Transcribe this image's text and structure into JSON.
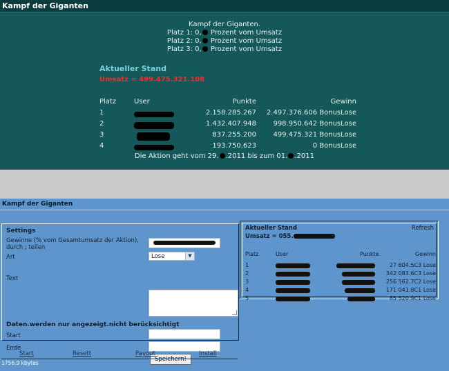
{
  "top": {
    "title": "Kampf der Giganten",
    "intro": {
      "heading": "Kampf der Giganten.",
      "lines": [
        {
          "prefix": "Platz 1: 0,",
          "suffix": " Prozent vom Umsatz"
        },
        {
          "prefix": "Platz 2: 0,",
          "suffix": " Prozent vom Umsatz"
        },
        {
          "prefix": "Platz 3: 0,",
          "suffix": " Prozent vom Umsatz"
        }
      ]
    },
    "stand_label": "Aktueller Stand",
    "umsatz": "Umsatz = 499.475.321.108",
    "headers": {
      "platz": "Platz",
      "user": "User",
      "punkte": "Punkte",
      "gewinn": "Gewinn"
    },
    "rows": [
      {
        "platz": "1",
        "punkte": "2.158.285.267",
        "gewinn": "2.497.376.606 BonusLose"
      },
      {
        "platz": "2",
        "punkte": "1.432.407.948",
        "gewinn": "998.950.642 BonusLose"
      },
      {
        "platz": "3",
        "punkte": "837.255.200",
        "gewinn": "499.475.321 BonusLose"
      },
      {
        "platz": "4",
        "punkte": "193.750.623",
        "gewinn": "0 BonusLose"
      }
    ],
    "aktion": {
      "p1": "Die Aktion geht vom 29.",
      "p2": ".2011 bis zum 01.",
      "p3": ".2011"
    }
  },
  "bottom": {
    "title": "Kampf der Giganten",
    "settings": {
      "title": "Settings",
      "gewinne_label": "Gewinne (% vom Gesamtumsatz der Aktion), durch ; teilen",
      "art_label": "Art",
      "art_value": "Lose",
      "text_label": "Text",
      "daten_label": "Daten.werden nur angezeigt.nicht berücksichtigt",
      "start_label": "Start",
      "ende_label": "Ende",
      "save_label": "Speichern!"
    },
    "tabs": [
      "Start",
      "Resett",
      "Payout",
      "Install"
    ],
    "filesize": "1756.9 kbytes",
    "stand": {
      "title": "Aktueller Stand",
      "refresh": "Refresh",
      "umsatz_prefix": "Umsatz = 055.",
      "headers": {
        "platz": "Platz",
        "user": "User",
        "punkte": "Punkte",
        "gewinn": "Gewinn"
      },
      "rows": [
        {
          "platz": "1",
          "gewinn": "27 604.5C3 Lose"
        },
        {
          "platz": "2",
          "gewinn": "342 083.6C3 Lose"
        },
        {
          "platz": "3",
          "gewinn": "256 562.7C2 Lose"
        },
        {
          "platz": "4",
          "gewinn": "171 041.8C1 Lose"
        },
        {
          "platz": "5",
          "gewinn": "85 520.9C1 Lose"
        }
      ]
    }
  },
  "colors": {
    "teal": "#15585a",
    "blue": "#5e95cc",
    "red": "#ff2626",
    "cyan": "#7ad1d8"
  }
}
